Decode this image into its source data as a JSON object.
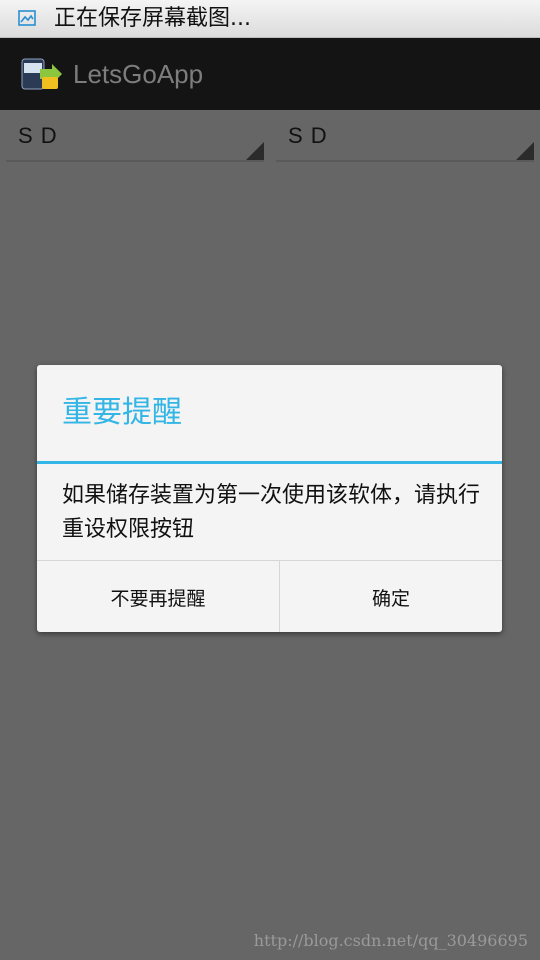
{
  "status_bar": {
    "icon": "screenshot-icon",
    "text": "正在保存屏幕截图..."
  },
  "action_bar": {
    "icon": "app-icon",
    "title": "LetsGoApp"
  },
  "spinners": [
    {
      "value": "S D"
    },
    {
      "value": "S D"
    }
  ],
  "dialog": {
    "title": "重要提醒",
    "message": "如果储存装置为第一次使用该软体，请执行重设权限按钮",
    "negative_button": "不要再提醒",
    "positive_button": "确定"
  },
  "watermark": "http://blog.csdn.net/qq_30496695",
  "colors": {
    "accent": "#33b5e5",
    "action_bar": "#141414",
    "dim_overlay": "#666666",
    "dialog_bg": "#f4f4f4"
  }
}
